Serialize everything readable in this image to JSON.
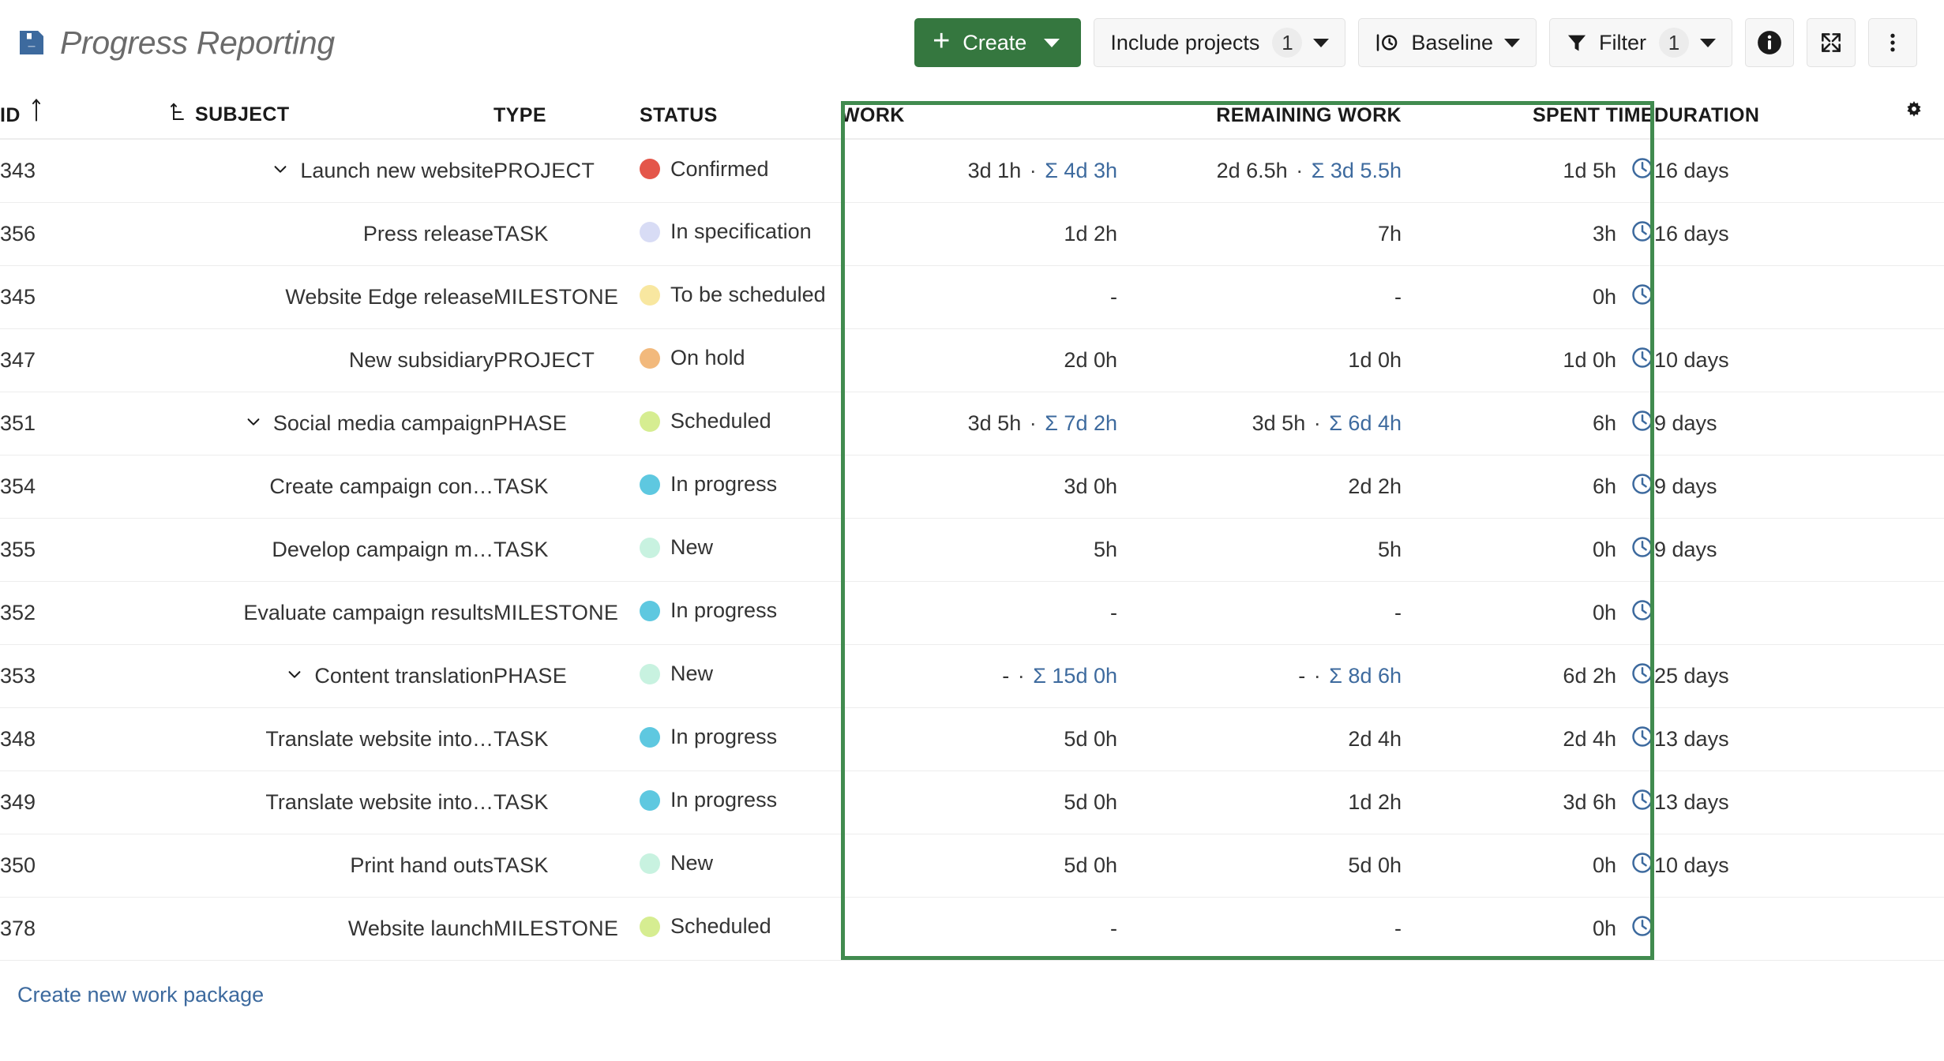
{
  "header": {
    "title": "Progress Reporting",
    "save_icon": "save-icon"
  },
  "toolbar": {
    "create_label": "Create",
    "include_projects_label": "Include projects",
    "include_projects_count": "1",
    "baseline_label": "Baseline",
    "filter_label": "Filter",
    "filter_count": "1",
    "info_icon": "info-icon",
    "fullscreen_icon": "fullscreen-icon",
    "more_icon": "more-vertical-icon"
  },
  "table": {
    "columns": [
      {
        "key": "id",
        "label": "ID"
      },
      {
        "key": "subject",
        "label": "SUBJECT"
      },
      {
        "key": "type",
        "label": "TYPE"
      },
      {
        "key": "status",
        "label": "STATUS"
      },
      {
        "key": "work",
        "label": "WORK"
      },
      {
        "key": "remaining_work",
        "label": "REMAINING WORK"
      },
      {
        "key": "spent_time",
        "label": "SPENT TIME"
      },
      {
        "key": "duration",
        "label": "DURATION"
      }
    ],
    "settings_icon": "gear-icon",
    "sort_icon": "sort-ascending-icon",
    "hierarchy_icon": "hierarchy-icon",
    "rows": [
      {
        "id": "343",
        "subject": "Launch new website",
        "indent": 0,
        "expanded": true,
        "type": "PROJECT",
        "status": "Confirmed",
        "status_color": "#e4564a",
        "work": "3d 1h",
        "work_sum": "Σ 4d 3h",
        "remaining": "2d 6.5h",
        "remaining_sum": "Σ 3d 5.5h",
        "spent": "1d 5h",
        "duration": "16 days"
      },
      {
        "id": "356",
        "subject": "Press release",
        "indent": 1,
        "expanded": false,
        "type": "TASK",
        "status": "In specification",
        "status_color": "#d8dcf5",
        "work": "1d 2h",
        "work_sum": "",
        "remaining": "7h",
        "remaining_sum": "",
        "spent": "3h",
        "duration": "16 days"
      },
      {
        "id": "345",
        "subject": "Website Edge release",
        "indent": 0,
        "expanded": false,
        "type": "MILESTONE",
        "status": "To be scheduled",
        "status_color": "#f8e7a0",
        "work": "-",
        "work_sum": "",
        "remaining": "-",
        "remaining_sum": "",
        "spent": "0h",
        "duration": ""
      },
      {
        "id": "347",
        "subject": "New subsidiary",
        "indent": 0,
        "expanded": false,
        "type": "PROJECT",
        "status": "On hold",
        "status_color": "#f2b97c",
        "work": "2d 0h",
        "work_sum": "",
        "remaining": "1d 0h",
        "remaining_sum": "",
        "spent": "1d 0h",
        "duration": "10 days"
      },
      {
        "id": "351",
        "subject": "Social media campaign",
        "indent": 0,
        "expanded": true,
        "type": "PHASE",
        "status": "Scheduled",
        "status_color": "#d6ed91",
        "work": "3d 5h",
        "work_sum": "Σ 7d 2h",
        "remaining": "3d 5h",
        "remaining_sum": "Σ 6d 4h",
        "spent": "6h",
        "duration": "9 days"
      },
      {
        "id": "354",
        "subject": "Create campaign con…",
        "indent": 2,
        "expanded": false,
        "type": "TASK",
        "status": "In progress",
        "status_color": "#5ec8e0",
        "work": "3d 0h",
        "work_sum": "",
        "remaining": "2d 2h",
        "remaining_sum": "",
        "spent": "6h",
        "duration": "9 days"
      },
      {
        "id": "355",
        "subject": "Develop campaign m…",
        "indent": 2,
        "expanded": false,
        "type": "TASK",
        "status": "New",
        "status_color": "#c8f2e0",
        "work": "5h",
        "work_sum": "",
        "remaining": "5h",
        "remaining_sum": "",
        "spent": "0h",
        "duration": "9 days"
      },
      {
        "id": "352",
        "subject": "Evaluate campaign results",
        "indent": 1,
        "expanded": false,
        "type": "MILESTONE",
        "status": "In progress",
        "status_color": "#5ec8e0",
        "work": "-",
        "work_sum": "",
        "remaining": "-",
        "remaining_sum": "",
        "spent": "0h",
        "duration": ""
      },
      {
        "id": "353",
        "subject": "Content translation",
        "indent": 0,
        "expanded": true,
        "type": "PHASE",
        "status": "New",
        "status_color": "#c8f2e0",
        "work": "-",
        "work_sum": "Σ 15d 0h",
        "remaining": "-",
        "remaining_sum": "Σ 8d 6h",
        "spent": "6d 2h",
        "duration": "25 days"
      },
      {
        "id": "348",
        "subject": "Translate website into…",
        "indent": 2,
        "expanded": false,
        "type": "TASK",
        "status": "In progress",
        "status_color": "#5ec8e0",
        "work": "5d 0h",
        "work_sum": "",
        "remaining": "2d 4h",
        "remaining_sum": "",
        "spent": "2d 4h",
        "duration": "13 days"
      },
      {
        "id": "349",
        "subject": "Translate website into…",
        "indent": 2,
        "expanded": false,
        "type": "TASK",
        "status": "In progress",
        "status_color": "#5ec8e0",
        "work": "5d 0h",
        "work_sum": "",
        "remaining": "1d 2h",
        "remaining_sum": "",
        "spent": "3d 6h",
        "duration": "13 days"
      },
      {
        "id": "350",
        "subject": "Print hand outs",
        "indent": 1,
        "expanded": false,
        "type": "TASK",
        "status": "New",
        "status_color": "#c8f2e0",
        "work": "5d 0h",
        "work_sum": "",
        "remaining": "5d 0h",
        "remaining_sum": "",
        "spent": "0h",
        "duration": "10 days"
      },
      {
        "id": "378",
        "subject": "Website launch",
        "indent": 0,
        "expanded": false,
        "type": "MILESTONE",
        "status": "Scheduled",
        "status_color": "#d6ed91",
        "work": "-",
        "work_sum": "",
        "remaining": "-",
        "remaining_sum": "",
        "spent": "0h",
        "duration": ""
      }
    ]
  },
  "footer": {
    "create_link_label": "Create new work package"
  },
  "highlight": {
    "color": "#418b4f",
    "columns": [
      "WORK",
      "REMAINING WORK",
      "SPENT TIME"
    ]
  }
}
